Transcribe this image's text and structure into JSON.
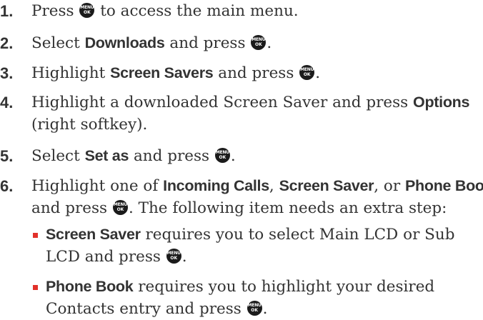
{
  "menu_key": {
    "top": "MENU",
    "bottom": "OK"
  },
  "steps": [
    {
      "num": "1.",
      "t1": "Press",
      "t2": "to access the main menu."
    },
    {
      "num": "2.",
      "t1": "Select",
      "b1": "Downloads",
      "t2": "and press",
      "t3": "."
    },
    {
      "num": "3.",
      "t1": "Highlight",
      "b1": "Screen Savers",
      "t2": "and press",
      "t3": "."
    },
    {
      "num": "4.",
      "t1": "Highlight a downloaded Screen Saver and press",
      "b1": "Options",
      "t2": "(right softkey)."
    },
    {
      "num": "5.",
      "t1": "Select",
      "b1": "Set as",
      "t2": "and press",
      "t3": "."
    },
    {
      "num": "6.",
      "t1": "Highlight one of",
      "b1": "Incoming Calls",
      "t2": ",",
      "b2": "Screen Saver",
      "t3": ", or",
      "b3": "Phone Book",
      "t4": "and press",
      "t5": ". The following item needs an extra step:"
    }
  ],
  "sub_steps": [
    {
      "b1": "Screen Saver",
      "t1": "requires you to select Main LCD or Sub LCD and press",
      "t2": "."
    },
    {
      "b1": "Phone Book",
      "t1": "requires you to highlight your desired Contacts entry and press",
      "t2": "."
    }
  ],
  "colors": {
    "text": "#333333",
    "bullet": "#e2312a",
    "key": "#1b1b1b"
  }
}
